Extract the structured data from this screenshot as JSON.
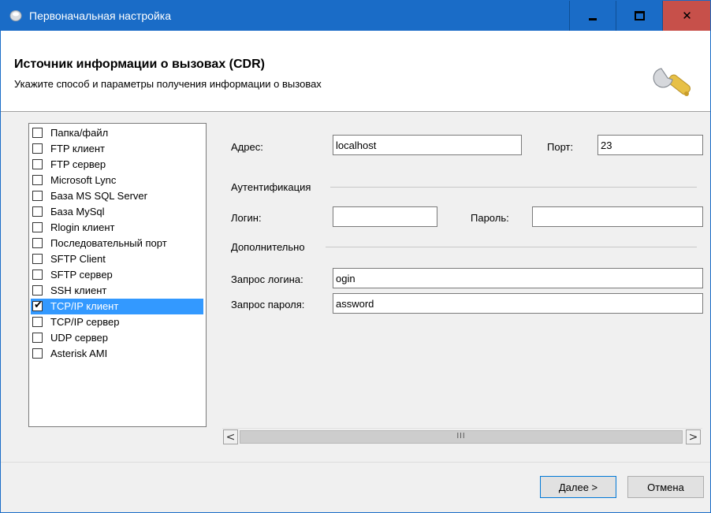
{
  "window": {
    "title": "Первоначальная настройка",
    "controls": {
      "minimize_icon": "minimize-icon",
      "maximize_icon": "maximize-icon",
      "close_icon": "close-icon"
    }
  },
  "header": {
    "title": "Источник информации о вызовах (CDR)",
    "subtitle": "Укажите способ и параметры получения информации о вызовах",
    "icon": "wrench-icon"
  },
  "sources": {
    "items": [
      {
        "label": "Папка/файл",
        "checked": false
      },
      {
        "label": "FTP клиент",
        "checked": false
      },
      {
        "label": "FTP сервер",
        "checked": false
      },
      {
        "label": "Microsoft Lync",
        "checked": false
      },
      {
        "label": "База MS SQL Server",
        "checked": false
      },
      {
        "label": "База MySql",
        "checked": false
      },
      {
        "label": "Rlogin клиент",
        "checked": false
      },
      {
        "label": "Последовательный порт",
        "checked": false
      },
      {
        "label": "SFTP Client",
        "checked": false
      },
      {
        "label": "SFTP сервер",
        "checked": false
      },
      {
        "label": "SSH клиент",
        "checked": false
      },
      {
        "label": "TCP/IP клиент",
        "checked": true,
        "selected": true
      },
      {
        "label": "TCP/IP сервер",
        "checked": false
      },
      {
        "label": "UDP сервер",
        "checked": false
      },
      {
        "label": "Asterisk AMI",
        "checked": false
      }
    ]
  },
  "form": {
    "address_label": "Адрес:",
    "address_value": "localhost",
    "port_label": "Порт:",
    "port_value": "23",
    "auth_group": "Аутентификация",
    "login_label": "Логин:",
    "login_value": "",
    "password_label": "Пароль:",
    "password_value": "",
    "extra_group": "Дополнительно",
    "login_prompt_label": "Запрос логина:",
    "login_prompt_value": "ogin",
    "password_prompt_label": "Запрос пароля:",
    "password_prompt_value": "assword"
  },
  "scrollbar": {
    "left_arrow": "<",
    "right_arrow": ">",
    "grip": "III"
  },
  "buttons": {
    "next": "Далее >",
    "cancel": "Отмена"
  },
  "colors": {
    "title_bar": "#1a6cc7",
    "close_button": "#c7504a",
    "selection": "#3399ff"
  }
}
